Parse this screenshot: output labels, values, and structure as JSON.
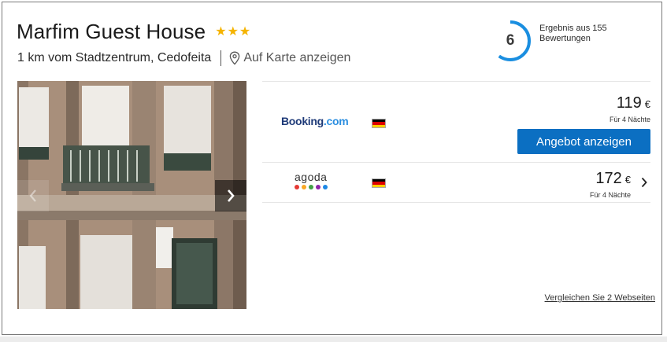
{
  "hotel": {
    "name": "Marfim Guest House",
    "stars": 3,
    "location": "1 km vom Stadtzentrum, Cedofeita",
    "map_link": "Auf Karte anzeigen"
  },
  "rating": {
    "score": "6",
    "text": "Ergebnis aus 155 Bewertungen",
    "fraction": 0.6,
    "color": "#1a8ee0"
  },
  "offers": [
    {
      "provider": "Booking.com",
      "provider_main": "Booking",
      "provider_tld": ".com",
      "price": "119",
      "currency": "€",
      "nights": "Für 4 Nächte",
      "cta": "Angebot anzeigen"
    },
    {
      "provider": "agoda",
      "price": "172",
      "currency": "€",
      "nights": "Für 4 Nächte"
    }
  ],
  "compare_link": "Vergleichen Sie 2 Webseiten",
  "colors": {
    "cta": "#0b6fc2",
    "star": "#f5b400",
    "booking": "#1e3a78",
    "agoda_dots": [
      "#e53935",
      "#f9a825",
      "#43a047",
      "#8e24aa",
      "#1e88e5"
    ]
  },
  "icons": [
    "map-pin-icon",
    "star-icon",
    "chevron-left-icon",
    "chevron-right-icon",
    "flag-de-icon"
  ]
}
